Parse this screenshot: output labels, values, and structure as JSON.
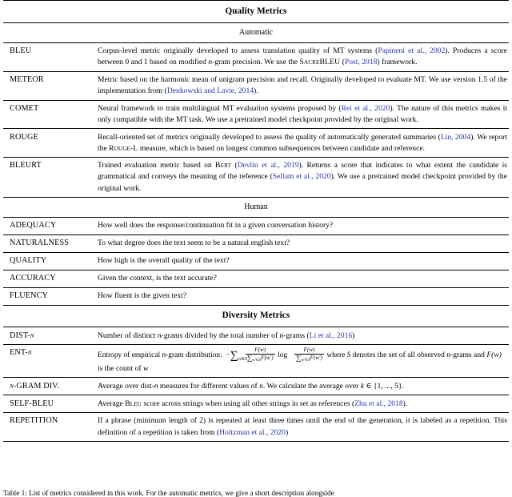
{
  "table": {
    "sections": [
      {
        "id": "quality",
        "title": "Quality Metrics",
        "subsections": [
          {
            "id": "automatic",
            "title": "Automatic",
            "rows": [
              {
                "name": "BLEU",
                "desc_plain": "Corpus-level metric originally developed to assess translation quality of MT systems (Papineni et al., 2002). Produces a score between 0 and 1 based on modified n-gram precision. We use the SACREBLEU (Post, 2018) framework.",
                "parts": [
                  {
                    "t": "Corpus-level metric originally developed to assess translation quality of MT systems ("
                  },
                  {
                    "t": "Papineni et al., 2002",
                    "s": "cite"
                  },
                  {
                    "t": "). Produces a score between 0 and 1 based on modified "
                  },
                  {
                    "t": "n",
                    "s": "it"
                  },
                  {
                    "t": "-gram precision. We use the "
                  },
                  {
                    "t": "SacreBLEU",
                    "s": "sc"
                  },
                  {
                    "t": " ("
                  },
                  {
                    "t": "Post, 2018",
                    "s": "cite"
                  },
                  {
                    "t": ") framework."
                  }
                ]
              },
              {
                "name": "METEOR",
                "desc_plain": "Metric based on the harmonic mean of unigram precision and recall. Originally developed to evaluate MT. We use version 1.5 of the implementation from (Denkowski and Lavie, 2014).",
                "parts": [
                  {
                    "t": "Metric based on the harmonic mean of unigram precision and recall. Originally developed to evaluate MT. We use version 1.5 of the implementation from ("
                  },
                  {
                    "t": "Denkowski and Lavie, 2014",
                    "s": "cite"
                  },
                  {
                    "t": ")."
                  }
                ]
              },
              {
                "name": "COMET",
                "desc_plain": "Neural framework to train multilingual MT evaluation systems proposed by (Rei et al., 2020). The nature of this metrics makes it only compatible with the MT task. We use a pretrained model checkpoint provided by the original work.",
                "parts": [
                  {
                    "t": "Neural framework to train multilingual MT evaluation systems proposed by ("
                  },
                  {
                    "t": "Rei et al., 2020",
                    "s": "cite"
                  },
                  {
                    "t": "). The nature of this metrics makes it only compatible with the MT task. We use a pretrained model checkpoint provided by the original work."
                  }
                ]
              },
              {
                "name": "ROUGE",
                "desc_plain": "Recall-oriented set of metrics originally developed to assess the quality of automatically generated summaries (Lin, 2004). We report the ROUGE-L measure, which is based on longest common subsequences between candidate and reference.",
                "parts": [
                  {
                    "t": "Recall-oriented set of metrics originally developed to assess the quality of automatically generated summaries ("
                  },
                  {
                    "t": "Lin, 2004",
                    "s": "cite"
                  },
                  {
                    "t": "). We report the "
                  },
                  {
                    "t": "Rouge-L",
                    "s": "sc"
                  },
                  {
                    "t": " measure, which is based on longest common subsequences between candidate and reference."
                  }
                ]
              },
              {
                "name": "BLEURT",
                "desc_plain": "Trained evaluation metric based on BERT (Devlin et al., 2019). Returns a score that indicates to what extent the candidate is grammatical and conveys the meaning of the reference (Sellam et al., 2020). We use a pretrained model checkpoint provided by the original work.",
                "parts": [
                  {
                    "t": "Trained evaluation metric based on "
                  },
                  {
                    "t": "Bert",
                    "s": "sc"
                  },
                  {
                    "t": " ("
                  },
                  {
                    "t": "Devlin et al., 2019",
                    "s": "cite"
                  },
                  {
                    "t": "). Returns a score that indicates to what extent the candidate is grammatical and conveys the meaning of the reference ("
                  },
                  {
                    "t": "Sellam et al., 2020",
                    "s": "cite"
                  },
                  {
                    "t": "). We use a pretrained model checkpoint provided by the original work."
                  }
                ]
              }
            ]
          },
          {
            "id": "human",
            "title": "Human",
            "rows": [
              {
                "name": "ADEQUACY",
                "desc_plain": "How well does the response/continuation fit in a given conversation history?",
                "parts": [
                  {
                    "t": "How well does the response/continuation fit in a given conversation history?"
                  }
                ]
              },
              {
                "name": "NATURALNESS",
                "desc_plain": "To what degree does the text seem to be a natural english text?",
                "parts": [
                  {
                    "t": "To what degree does the text seem to be a natural english text?"
                  }
                ]
              },
              {
                "name": "QUALITY",
                "desc_plain": "How high is the overall quality of the text?",
                "parts": [
                  {
                    "t": "How high is the overall quality of the text?"
                  }
                ]
              },
              {
                "name": "ACCURACY",
                "desc_plain": "Given the context, is the text accurate?",
                "parts": [
                  {
                    "t": "Given the context, is the text accurate?"
                  }
                ]
              },
              {
                "name": "FLUENCY",
                "desc_plain": "How fluent is the given text?",
                "parts": [
                  {
                    "t": "How fluent is the given text?"
                  }
                ]
              }
            ]
          }
        ]
      },
      {
        "id": "diversity",
        "title": "Diversity Metrics",
        "subsections": [
          {
            "id": "diversity-rows",
            "title": null,
            "rows": [
              {
                "name": "DIST-n",
                "name_italic_tail": "n",
                "desc_plain": "Number of distinct n-grams divided by the total number of n-grams (Li et al., 2016)",
                "parts": [
                  {
                    "t": "Number of distinct "
                  },
                  {
                    "t": "n",
                    "s": "it"
                  },
                  {
                    "t": "-grams divided by the total number of "
                  },
                  {
                    "t": "n",
                    "s": "it"
                  },
                  {
                    "t": "-grams ("
                  },
                  {
                    "t": "Li et al., 2016",
                    "s": "cite"
                  },
                  {
                    "t": ")"
                  }
                ]
              },
              {
                "name": "ENT-n",
                "name_italic_tail": "n",
                "has_formula": true,
                "desc_plain": "Entropy of empirical n-gram distribution: -sum_{w in S} F(w)/sum_{w' in S} F(w') log F(w)/sum_{w' in S} F(w') where S denotes the set of all observed n-grams and F(w) is the count of w",
                "formula": {
                  "lead": "Entropy of empirical ",
                  "lead_it": "n",
                  "lead2": "-gram distribution:",
                  "minus": "−",
                  "sigma": "∑",
                  "sigma_sub": "w∈S",
                  "num": "F(w)",
                  "den_sigma": "∑",
                  "den_sub": "w′∈S",
                  "den_fn": "F(w′)",
                  "log": "log",
                  "tail_a": "where ",
                  "tail_S": "S",
                  "tail_b": " denotes"
                },
                "line2": {
                  "a": "the set of all observed ",
                  "it1": "n",
                  "b": "-grams and ",
                  "fw": "F(w)",
                  "c": " is the count of ",
                  "it2": "w"
                }
              },
              {
                "name": "n-GRAM DIV.",
                "name_italic_head": "n",
                "desc_plain": "Average over dist-n measures for different values of n. We calculate the average over k in {1, ..., 5}.",
                "parts": [
                  {
                    "t": "Average over dist-"
                  },
                  {
                    "t": "n",
                    "s": "it"
                  },
                  {
                    "t": " measures for different values of "
                  },
                  {
                    "t": "n",
                    "s": "it"
                  },
                  {
                    "t": ". We calculate the average over "
                  },
                  {
                    "t": "k",
                    "s": "it"
                  },
                  {
                    "t": " ∈ {1, ..., 5}."
                  }
                ]
              },
              {
                "name": "SELF-BLEU",
                "desc_plain": "Average BLEU score across strings when using all other strings in set as references (Zhu et al., 2018).",
                "parts": [
                  {
                    "t": "Average "
                  },
                  {
                    "t": "Bleu",
                    "s": "sc"
                  },
                  {
                    "t": " score across strings when using all other strings in set as references ("
                  },
                  {
                    "t": "Zhu et al., 2018",
                    "s": "cite"
                  },
                  {
                    "t": ")."
                  }
                ]
              },
              {
                "name": "REPETITION",
                "desc_plain": "If a phrase (minimum length of 2) is repeated at least three times until the end of the generation, it is labeled as a repetition. This definition of a repetition is taken from (Holtzman et al., 2020)",
                "parts": [
                  {
                    "t": "If a phrase (minimum length of 2) is repeated at least three times until the end of the generation, it is labeled as a repetition. This definition of a repetition is taken from ("
                  },
                  {
                    "t": "Holtzman et al., 2020",
                    "s": "cite"
                  },
                  {
                    "t": ")"
                  }
                ]
              }
            ]
          }
        ]
      }
    ]
  },
  "caption": {
    "label": "Table 1:",
    "text": "List of metrics considered in this work. For the automatic metrics, we give a short description alongside"
  },
  "colors": {
    "citation_link": "#2a35a8",
    "text": "#000000",
    "rule": "#000000",
    "background": "#ffffff"
  }
}
